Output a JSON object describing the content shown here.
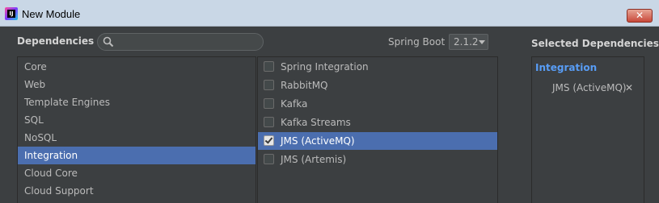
{
  "window": {
    "title": "New Module"
  },
  "header": {
    "dependencies_label": "Dependencies",
    "search_placeholder": "",
    "spring_boot_label": "Spring Boot",
    "spring_boot_version": "2.1.2",
    "selected_label": "Selected Dependencies"
  },
  "categories": [
    {
      "label": "Core"
    },
    {
      "label": "Web"
    },
    {
      "label": "Template Engines"
    },
    {
      "label": "SQL"
    },
    {
      "label": "NoSQL"
    },
    {
      "label": "Integration"
    },
    {
      "label": "Cloud Core"
    },
    {
      "label": "Cloud Support"
    }
  ],
  "selected_category": "Integration",
  "dependencies": [
    {
      "label": "Spring Integration",
      "checked": false
    },
    {
      "label": "RabbitMQ",
      "checked": false
    },
    {
      "label": "Kafka",
      "checked": false
    },
    {
      "label": "Kafka Streams",
      "checked": false
    },
    {
      "label": "JMS (ActiveMQ)",
      "checked": true
    },
    {
      "label": "JMS (Artemis)",
      "checked": false
    }
  ],
  "selected_dependency": "JMS (ActiveMQ)",
  "selected_panel": {
    "group": "Integration",
    "items": [
      {
        "label": "JMS (ActiveMQ)",
        "remove": "✕"
      }
    ]
  },
  "colors": {
    "background": "#3c3f41",
    "selection": "#4b6eaf",
    "group_accent": "#589df6"
  }
}
